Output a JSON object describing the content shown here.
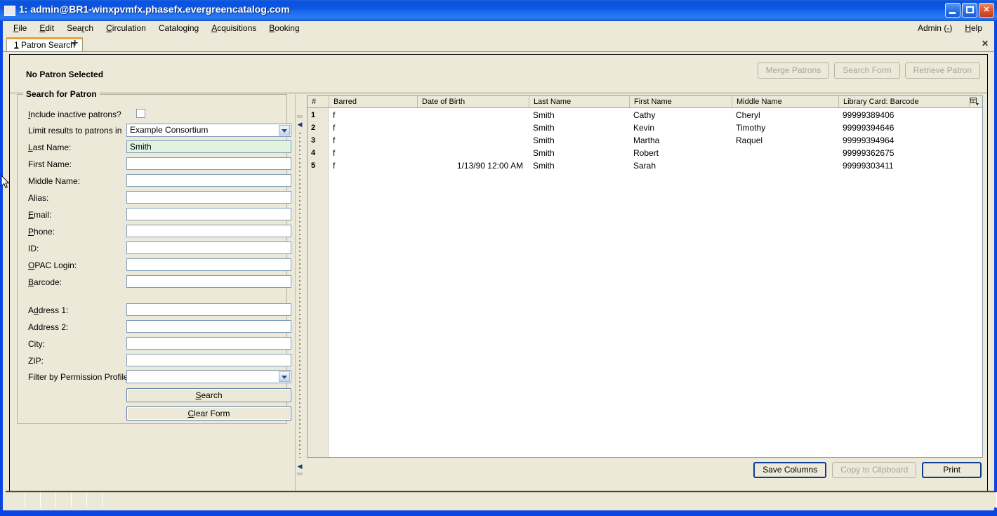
{
  "window": {
    "title": "1: admin@BR1-winxpvmfx.phasefx.evergreencatalog.com",
    "icon": "app-icon",
    "minimize": "minimize-icon",
    "maximize": "maximize-icon",
    "close": "close-icon"
  },
  "menubar": {
    "items": [
      {
        "label": "File",
        "mnemonic": "F"
      },
      {
        "label": "Edit",
        "mnemonic": "E"
      },
      {
        "label": "Search",
        "mnemonic": "r"
      },
      {
        "label": "Circulation",
        "mnemonic": "C"
      },
      {
        "label": "Cataloging",
        "mnemonic": "g"
      },
      {
        "label": "Acquisitions",
        "mnemonic": "A"
      },
      {
        "label": "Booking",
        "mnemonic": "B"
      }
    ],
    "right": [
      {
        "label": "Admin (-)",
        "mnemonic": "-"
      },
      {
        "label": "Help",
        "mnemonic": "H"
      }
    ]
  },
  "tabs": {
    "active": {
      "number": "1",
      "label": "Patron Search"
    },
    "add_label": "+",
    "close_label": "✕"
  },
  "patron_header": {
    "title": "No Patron Selected",
    "buttons": [
      {
        "label": "Merge Patrons",
        "disabled": true
      },
      {
        "label": "Search Form",
        "disabled": true
      },
      {
        "label": "Retrieve Patron",
        "disabled": true
      }
    ]
  },
  "search_form": {
    "legend": "Search for Patron",
    "fields": [
      {
        "label": "Include inactive patrons?",
        "type": "checkbox",
        "checked": false,
        "value": ""
      },
      {
        "label": "Limit results to patrons in",
        "type": "select",
        "value": "Example Consortium"
      },
      {
        "label": "Last Name:",
        "type": "text",
        "value": "Smith",
        "highlight": true
      },
      {
        "label": "First Name:",
        "type": "text",
        "value": ""
      },
      {
        "label": "Middle Name:",
        "type": "text",
        "value": ""
      },
      {
        "label": "Alias:",
        "type": "text",
        "value": ""
      },
      {
        "label": "Email:",
        "type": "text",
        "value": ""
      },
      {
        "label": "Phone:",
        "type": "text",
        "value": ""
      },
      {
        "label": "ID:",
        "type": "text",
        "value": ""
      },
      {
        "label": "OPAC Login:",
        "type": "text",
        "value": ""
      },
      {
        "label": "Barcode:",
        "type": "text",
        "value": ""
      },
      {
        "label": "Address 1:",
        "type": "text",
        "value": ""
      },
      {
        "label": "Address 2:",
        "type": "text",
        "value": ""
      },
      {
        "label": "City:",
        "type": "text",
        "value": ""
      },
      {
        "label": "ZIP:",
        "type": "text",
        "value": ""
      },
      {
        "label": "Filter by Permission Profile:",
        "type": "select",
        "value": ""
      }
    ],
    "search_button": "Search",
    "clear_button": "Clear Form"
  },
  "results": {
    "columns": [
      "#",
      "Barred",
      "Date of Birth",
      "Last Name",
      "First Name",
      "Middle Name",
      "Library Card: Barcode"
    ],
    "column_picker_icon": "column-picker-icon",
    "rows": [
      {
        "num": "1",
        "barred": "f",
        "dob": "",
        "last": "Smith",
        "first": "Cathy",
        "middle": "Cheryl",
        "barcode": "99999389406"
      },
      {
        "num": "2",
        "barred": "f",
        "dob": "",
        "last": "Smith",
        "first": "Kevin",
        "middle": "Timothy",
        "barcode": "99999394646"
      },
      {
        "num": "3",
        "barred": "f",
        "dob": "",
        "last": "Smith",
        "first": "Martha",
        "middle": "Raquel",
        "barcode": "99999394964"
      },
      {
        "num": "4",
        "barred": "f",
        "dob": "",
        "last": "Smith",
        "first": "Robert",
        "middle": "",
        "barcode": "99999362675"
      },
      {
        "num": "5",
        "barred": "f",
        "dob": "1/13/90 12:00 AM",
        "last": "Smith",
        "first": "Sarah",
        "middle": "",
        "barcode": "99999303411"
      }
    ],
    "footer_buttons": [
      {
        "label": "Save Columns",
        "disabled": false,
        "strong": true
      },
      {
        "label": "Copy to Clipboard",
        "disabled": true,
        "strong": false
      },
      {
        "label": "Print",
        "disabled": false,
        "strong": true
      }
    ]
  },
  "splitter": {
    "collapse_up_icon": "collapse-left-arrow-icon",
    "collapse_down_icon": "collapse-left-arrow-icon",
    "up_glyph": "◀",
    "down_glyph": "◀"
  },
  "statusbar": {
    "segments": [
      "",
      "",
      "",
      "",
      "",
      "",
      ""
    ]
  },
  "colors": {
    "window_face": "#ece9d8",
    "title_blue": "#0a53dd",
    "field_border": "#7f9db9",
    "highlight_green": "#dff3df",
    "tab_accent": "#e8a33d"
  }
}
